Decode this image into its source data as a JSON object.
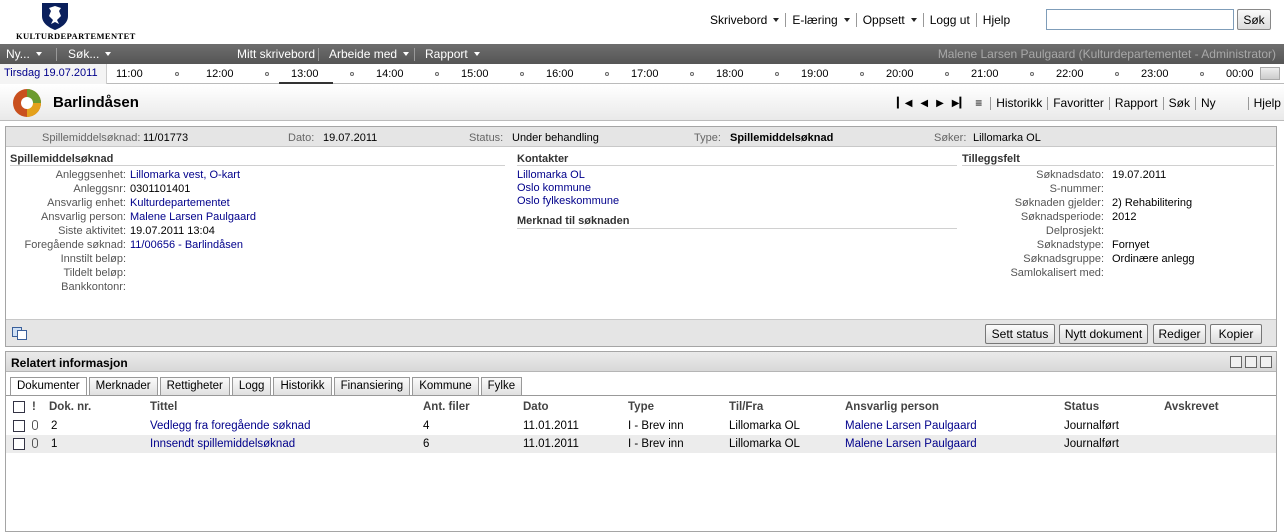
{
  "header": {
    "logo_text": "KULTURDEPARTEMENTET",
    "nav": [
      {
        "label": "Skrivebord",
        "dropdown": true
      },
      {
        "label": "E-læring",
        "dropdown": true
      },
      {
        "label": "Oppsett",
        "dropdown": true
      },
      {
        "label": "Logg ut",
        "dropdown": false
      },
      {
        "label": "Hjelp",
        "dropdown": false
      }
    ],
    "search_value": "",
    "search_button": "Søk"
  },
  "menubar": {
    "new": "Ny...",
    "search": "Søk...",
    "desk": "Mitt skrivebord",
    "work": "Arbeide med",
    "report": "Rapport",
    "user": "Malene Larsen Paulgaard (Kulturdepartementet - Administrator)"
  },
  "timeline": {
    "date": "Tirsdag 19.07.2011",
    "hours": [
      "11:00",
      "12:00",
      "13:00",
      "14:00",
      "15:00",
      "16:00",
      "17:00",
      "18:00",
      "19:00",
      "20:00",
      "21:00",
      "22:00",
      "23:00",
      "00:00"
    ],
    "current": "13:00"
  },
  "titlebar": {
    "title": "Barlindåsen",
    "links": [
      "Historikk",
      "Favoritter",
      "Rapport",
      "Søk",
      "Ny",
      "Hjelp"
    ]
  },
  "summary": {
    "type_label": "Spillemiddelsøknad:",
    "type_value": "11/01773",
    "date_label": "Dato:",
    "date_value": "19.07.2011",
    "status_label": "Status:",
    "status_value": "Under behandling",
    "kind_label": "Type:",
    "kind_value": "Spillemiddelsøknad",
    "applicant_label": "Søker:",
    "applicant_value": "Lillomarka OL"
  },
  "sections": {
    "main": "Spillemiddelsøknad",
    "contacts": "Kontakter",
    "note": "Merknad til søknaden",
    "extra": "Tilleggsfelt"
  },
  "details": [
    {
      "label": "Anleggsenhet:",
      "value": "Lillomarka vest, O-kart",
      "link": true
    },
    {
      "label": "Anleggsnr:",
      "value": "0301101401",
      "link": false
    },
    {
      "label": "Ansvarlig enhet:",
      "value": "Kulturdepartementet",
      "link": true
    },
    {
      "label": "Ansvarlig person:",
      "value": "Malene Larsen Paulgaard",
      "link": true
    },
    {
      "label": "Siste aktivitet:",
      "value": "19.07.2011 13:04",
      "link": false
    },
    {
      "label": "Foregående søknad:",
      "value": "11/00656 - Barlindåsen",
      "link": true
    },
    {
      "label": "Innstilt beløp:",
      "value": "",
      "link": false
    },
    {
      "label": "Tildelt beløp:",
      "value": "",
      "link": false
    },
    {
      "label": "Bankkontonr:",
      "value": "",
      "link": false
    }
  ],
  "contacts": [
    "Lillomarka OL",
    "Oslo kommune",
    "Oslo fylkeskommune"
  ],
  "extra_fields": [
    {
      "label": "Søknadsdato:",
      "value": "19.07.2011"
    },
    {
      "label": "S-nummer:",
      "value": ""
    },
    {
      "label": "Søknaden gjelder:",
      "value": "2) Rehabilitering"
    },
    {
      "label": "Søknadsperiode:",
      "value": "2012"
    },
    {
      "label": "Delprosjekt:",
      "value": ""
    },
    {
      "label": "Søknadstype:",
      "value": "Fornyet"
    },
    {
      "label": "Søknadsgruppe:",
      "value": "Ordinære anlegg"
    },
    {
      "label": "Samlokalisert med:",
      "value": ""
    }
  ],
  "actions": [
    "Sett status",
    "Nytt dokument",
    "Rediger",
    "Kopier"
  ],
  "related": {
    "title": "Relatert informasjon",
    "tabs": [
      "Dokumenter",
      "Merknader",
      "Rettigheter",
      "Logg",
      "Historikk",
      "Finansiering",
      "Kommune",
      "Fylke"
    ],
    "columns": [
      "!",
      "Dok. nr.",
      "Tittel",
      "Ant. filer",
      "Dato",
      "Type",
      "Til/Fra",
      "Ansvarlig person",
      "Status",
      "Avskrevet"
    ],
    "rows": [
      {
        "nr": "2",
        "title": "Vedlegg fra foregående søknad",
        "files": "4",
        "date": "11.01.2011",
        "type": "I - Brev inn",
        "tilfra": "Lillomarka OL",
        "person": "Malene Larsen Paulgaard",
        "status": "Journalført",
        "avskrevet": ""
      },
      {
        "nr": "1",
        "title": "Innsendt spillemiddelsøknad",
        "files": "6",
        "date": "11.01.2011",
        "type": "I - Brev inn",
        "tilfra": "Lillomarka OL",
        "person": "Malene Larsen Paulgaard",
        "status": "Journalført",
        "avskrevet": ""
      }
    ]
  },
  "colors": {
    "link": "#00008b",
    "menubar": "#5f5f5f",
    "panel_header": "#e5e5e5"
  }
}
